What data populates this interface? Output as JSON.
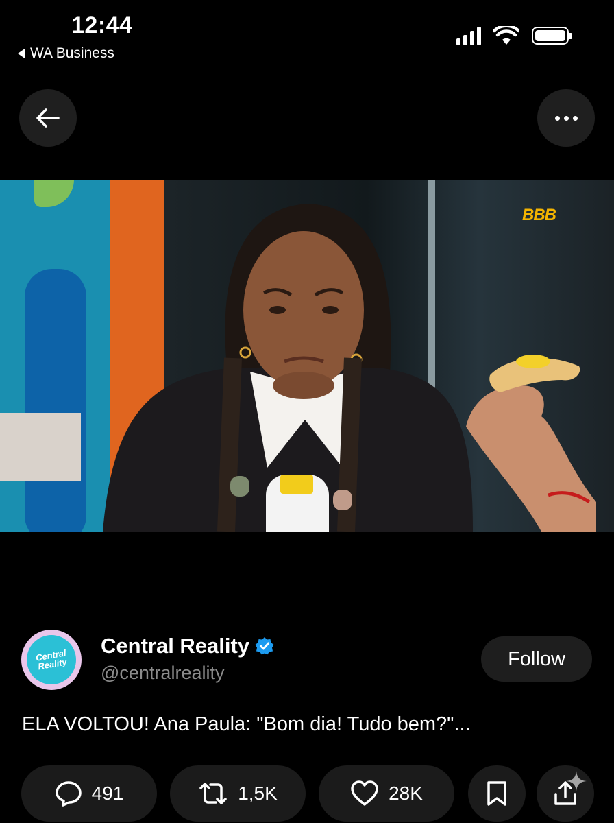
{
  "status_bar": {
    "time": "12:44",
    "back_app": "WA Business"
  },
  "nav": {
    "back_icon": "arrow-left-icon",
    "more_icon": "more-horizontal-icon"
  },
  "media": {
    "watermark": "BBB"
  },
  "author": {
    "display_name": "Central Reality",
    "handle": "@centralreality",
    "avatar_text_1": "Central",
    "avatar_text_2": "Reality",
    "verified_color": "#1d9bf0",
    "follow_label": "Follow"
  },
  "post": {
    "text": "ELA VOLTOU! Ana Paula: \"Bom dia! Tudo bem?\"..."
  },
  "actions": {
    "replies": "491",
    "reposts": "1,5K",
    "likes": "28K"
  },
  "colors": {
    "background": "#000000",
    "pill": "#1b1b1b",
    "muted_text": "#8b8b8b",
    "accent_logo": "#f4b400"
  }
}
